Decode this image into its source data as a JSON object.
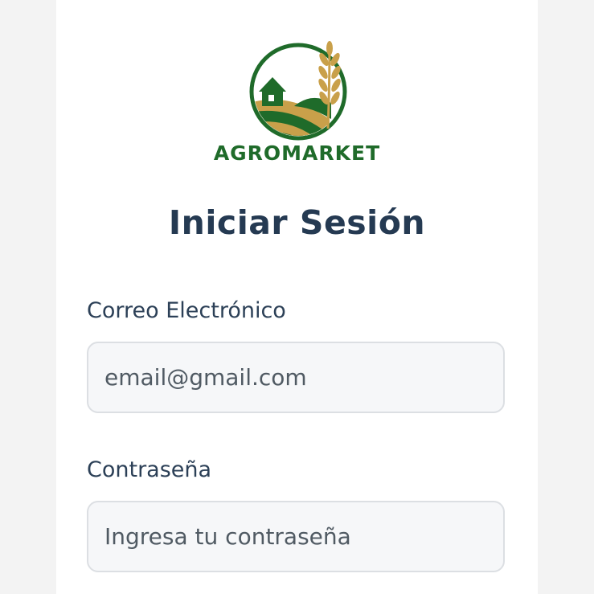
{
  "brand": {
    "name": "AGROMARKET",
    "colors": {
      "green": "#1f6b2a",
      "gold": "#c9a04a"
    }
  },
  "login": {
    "title": "Iniciar Sesión",
    "email_label": "Correo Electrónico",
    "email_placeholder": "email@gmail.com",
    "password_label": "Contraseña",
    "password_placeholder": "Ingresa tu contraseña"
  }
}
